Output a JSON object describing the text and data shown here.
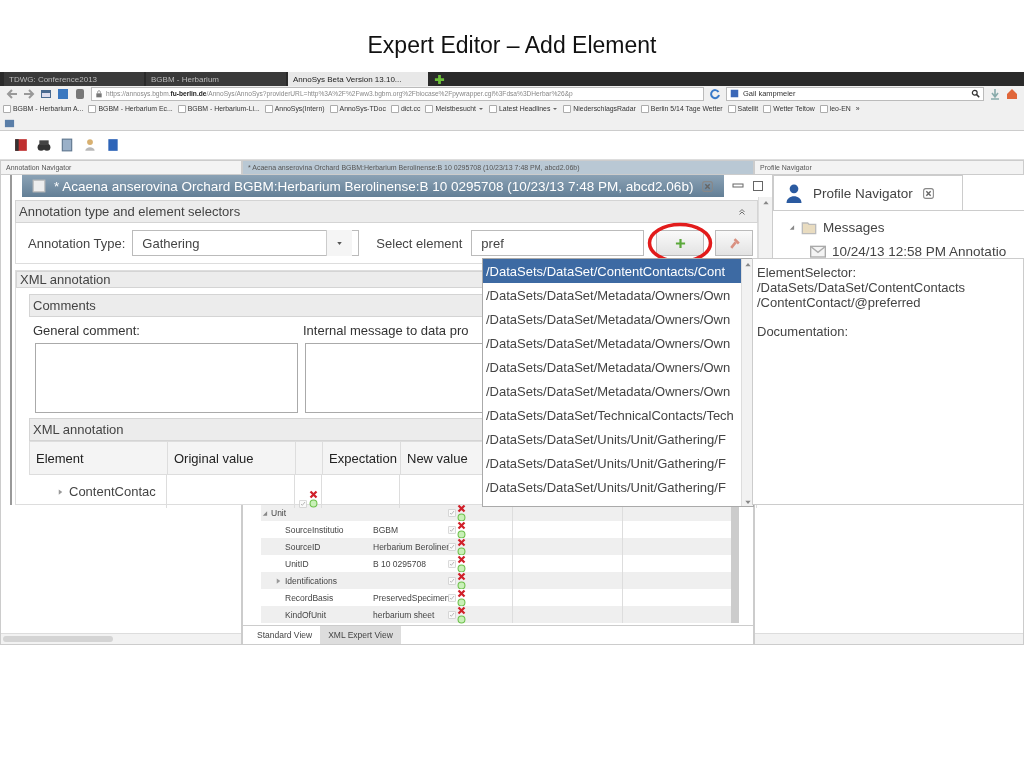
{
  "slide_title": "Expert Editor – Add Element",
  "browser": {
    "tabs": [
      {
        "label": "TDWG: Conference2013",
        "selected": false
      },
      {
        "label": "BGBM - Herbarium",
        "selected": false
      },
      {
        "label": "AnnoSys Beta Version 13.10...",
        "selected": true
      }
    ],
    "url": "https://annosys.bgbm.**fu-berlin.de**/AnnoSys/AnnoSys?providerURL=http%3A%2F%2Fww3.bgbm.org%2Fbiocase%2Fpywrapper.cgi%3Fdsa%3DHerbar%26&p",
    "search": "Gail kampmeier",
    "bookmarks": [
      {
        "label": "BGBM - Herbarium A...",
        "kind": "link"
      },
      {
        "label": "BGBM - Herbarium Ec...",
        "kind": "link"
      },
      {
        "label": "BGBM - Herbarium-Li...",
        "kind": "link"
      },
      {
        "label": "AnnoSys(Intern)",
        "kind": "link"
      },
      {
        "label": "AnnoSys-TDoc",
        "kind": "link"
      },
      {
        "label": "dict.cc",
        "kind": "link"
      },
      {
        "label": "Meistbesucht",
        "kind": "menu"
      },
      {
        "label": "Latest Headlines",
        "kind": "menu"
      },
      {
        "label": "NiederschlagsRadar",
        "kind": "link"
      },
      {
        "label": "Berlin 5/14 Tage Wetter",
        "kind": "link"
      },
      {
        "label": "Satellit",
        "kind": "link"
      },
      {
        "label": "Wetter Teltow",
        "kind": "link"
      },
      {
        "label": "leo-EN",
        "kind": "link"
      }
    ],
    "more": "»"
  },
  "workspace": {
    "left_panel": {
      "title": "Annotation Navigator"
    },
    "center_panel": {
      "title": "* Acaena anserovina Orchard BGBM:Herbarium Berolinense:B 10 0295708 (10/23/13 7:48 PM, abcd2.06b)",
      "rows": [
        {
          "element": "Unit",
          "expanded": true,
          "checked": true,
          "children": [
            {
              "element": "SourceInstitutio",
              "value": "BGBM",
              "checked": true
            },
            {
              "element": "SourceID",
              "value": "Herbarium Beroliner",
              "checked": true
            },
            {
              "element": "UnitID",
              "value": "B 10 0295708",
              "checked": true
            },
            {
              "element": "Identifications",
              "expanded": false,
              "checked": true
            },
            {
              "element": "RecordBasis",
              "value": "PreservedSpecimen",
              "checked": true
            },
            {
              "element": "KindOfUnit",
              "value": "herbarium sheet",
              "checked": true
            }
          ]
        }
      ],
      "view_tabs": [
        {
          "label": "Standard View",
          "selected": true
        },
        {
          "label": "XML Expert View",
          "selected": false
        }
      ]
    },
    "right_panel": {
      "title": "Profile Navigator"
    }
  },
  "editor": {
    "title": "* Acaena anserovina Orchard BGBM:Herbarium Berolinense:B 10 0295708 (10/23/13 7:48 PM, abcd2.06b)",
    "selectors": {
      "header": "Annotation type and element selectors",
      "type_label": "Annotation Type:",
      "type_value": "Gathering",
      "element_label": "Select element",
      "element_value": "pref"
    },
    "xml_annotation": {
      "header": "XML annotation",
      "comments": {
        "header": "Comments",
        "general_label": "General comment:",
        "internal_label": "Internal message to data pro"
      },
      "table": {
        "header": "XML annotation",
        "columns": [
          "Element",
          "Original value",
          "Expectation",
          "New value"
        ],
        "rows": [
          {
            "element": "ContentContac",
            "expanded": false,
            "checked": true
          }
        ]
      }
    },
    "suggestions": [
      {
        "path": "/DataSets/DataSet/ContentContacts/Cont",
        "selected": true
      },
      {
        "path": "/DataSets/DataSet/Metadata/Owners/Own",
        "selected": false
      },
      {
        "path": "/DataSets/DataSet/Metadata/Owners/Own",
        "selected": false
      },
      {
        "path": "/DataSets/DataSet/Metadata/Owners/Own",
        "selected": false
      },
      {
        "path": "/DataSets/DataSet/Metadata/Owners/Own",
        "selected": false
      },
      {
        "path": "/DataSets/DataSet/Metadata/Owners/Own",
        "selected": false
      },
      {
        "path": "/DataSets/DataSet/TechnicalContacts/Tech",
        "selected": false
      },
      {
        "path": "/DataSets/DataSet/Units/Unit/Gathering/F",
        "selected": false
      },
      {
        "path": "/DataSets/DataSet/Units/Unit/Gathering/F",
        "selected": false
      },
      {
        "path": "/DataSets/DataSet/Units/Unit/Gathering/F",
        "selected": false
      }
    ],
    "documentation": {
      "selector_label": "ElementSelector:",
      "selector_lines": [
        "/DataSets/DataSet/ContentContacts",
        "/ContentContact/@preferred"
      ],
      "doc_label": "Documentation:"
    }
  },
  "profile_navigator": {
    "title": "Profile Navigator",
    "tree": [
      {
        "label": "Messages",
        "expanded": true,
        "children": [
          {
            "label": "10/24/13 12:58 PM Annotatio"
          }
        ]
      }
    ]
  }
}
